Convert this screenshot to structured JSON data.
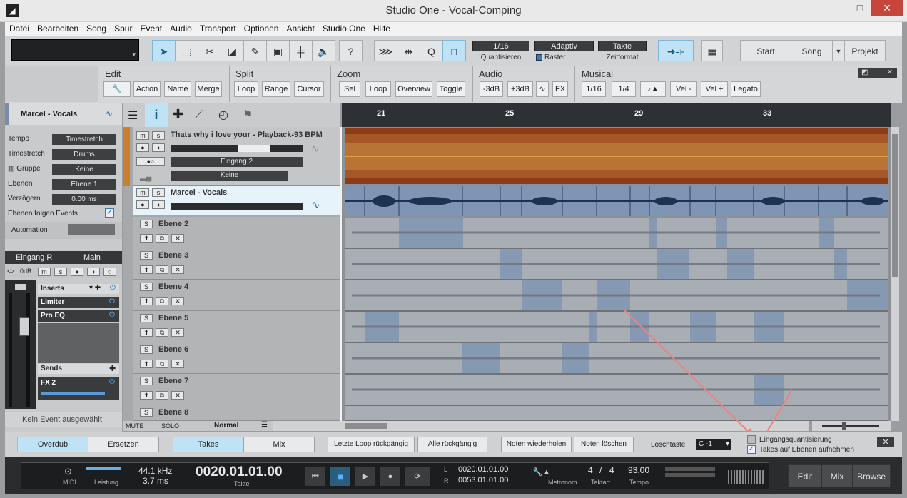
{
  "window": {
    "title": "Studio One - Vocal-Comping"
  },
  "menu": [
    "Datei",
    "Bearbeiten",
    "Song",
    "Spur",
    "Event",
    "Audio",
    "Transport",
    "Optionen",
    "Ansicht",
    "Studio One",
    "Hilfe"
  ],
  "toolbar": {
    "quantize": "1/16",
    "quantize_label": "Quantisieren",
    "snap": "Adaptiv",
    "snap_label": "Raster",
    "timeformat": "Takte",
    "timeformat_label": "Zeitformat",
    "help": "?",
    "start": "Start",
    "song": "Song",
    "projekt": "Projekt"
  },
  "editbar": {
    "edit": {
      "title": "Edit",
      "buttons": [
        "Action",
        "Name",
        "Merge"
      ]
    },
    "split": {
      "title": "Split",
      "buttons": [
        "Loop",
        "Range",
        "Cursor"
      ]
    },
    "zoom": {
      "title": "Zoom",
      "buttons": [
        "Sel",
        "Loop",
        "Overview",
        "Toggle"
      ]
    },
    "audio": {
      "title": "Audio",
      "buttons": [
        "-3dB",
        "+3dB",
        "FX"
      ]
    },
    "musical": {
      "title": "Musical",
      "buttons": [
        "1/16",
        "1/4",
        "Vel -",
        "Vel +",
        "Legato"
      ]
    }
  },
  "inspector": {
    "track_name": "Marcel - Vocals",
    "rows": [
      {
        "label": "Tempo",
        "value": "Timestretch"
      },
      {
        "label": "Timestretch",
        "value": "Drums"
      },
      {
        "label": "Gruppe",
        "value": "Keine"
      },
      {
        "label": "Ebenen",
        "value": "Ebene 1"
      },
      {
        "label": "Verzögern",
        "value": "0.00 ms"
      }
    ],
    "follow_label": "Ebenen folgen Events",
    "automation": "Automation",
    "input": "Eingang R",
    "output": "Main",
    "gain": "0dB",
    "inserts_label": "Inserts",
    "inserts": [
      "Limiter",
      "Pro EQ"
    ],
    "sends_label": "Sends",
    "sends": [
      "FX 2"
    ],
    "no_event": "Kein Event ausgewählt"
  },
  "tracks": {
    "playback": {
      "name": "Thats why i love your - Playback-93 BPM",
      "input": "Eingang 2",
      "output": "Keine"
    },
    "vocals": {
      "name": "Marcel - Vocals"
    },
    "layers": [
      "Ebene 2",
      "Ebene 3",
      "Ebene 4",
      "Ebene 5",
      "Ebene 6",
      "Ebene 7",
      "Ebene 8"
    ],
    "footer": {
      "mute": "MUTE",
      "solo": "SOLO",
      "normal": "Normal"
    }
  },
  "ruler": [
    "21",
    "25",
    "29",
    "33"
  ],
  "recbar": {
    "overdub": "Overdub",
    "ersetzen": "Ersetzen",
    "takes": "Takes",
    "mix": "Mix",
    "letzte": "Letzte Loop rückgängig",
    "alle": "Alle rückgängig",
    "noten_wdh": "Noten wiederholen",
    "noten_l": "Noten löschen",
    "loeschtaste": "Löschtaste",
    "loeschtaste_val": "C -1",
    "eingang_q": "Eingangsquantisierung",
    "takes_ebenen": "Takes auf Ebenen aufnehmen"
  },
  "transport": {
    "midi": "MIDI",
    "leistung": "Leistung",
    "rate": "44.1 kHz",
    "latency": "3.7 ms",
    "position": "0020.01.01.00",
    "position_label": "Takte",
    "loop_l": "0020.01.01.00",
    "loop_r": "0053.01.01.00",
    "L": "L",
    "R": "R",
    "metronom": "Metronom",
    "sig_num": "4",
    "sig_den": "4",
    "taktart": "Taktart",
    "tempo": "93.00",
    "tempo_label": "Tempo",
    "edit": "Edit",
    "mix": "Mix",
    "browse": "Browse"
  }
}
